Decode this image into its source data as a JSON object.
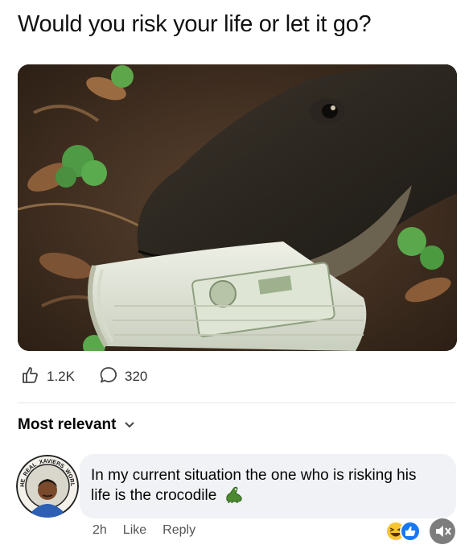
{
  "post": {
    "title": "Would you risk your life or let it go?"
  },
  "stats": {
    "likes": "1.2K",
    "comments": "320"
  },
  "comments_section": {
    "sort_label": "Most relevant"
  },
  "comment": {
    "avatar_badge_text": "THE_REAL_XAVIERS_WORLD",
    "text": "In my current situation the one who is risking his life is the crocodile",
    "emoji": "crocodile",
    "time": "2h",
    "like_label": "Like",
    "reply_label": "Reply"
  },
  "colors": {
    "bubble": "#f0f2f5",
    "meta_text": "#555555",
    "divider": "#e4e6eb"
  }
}
